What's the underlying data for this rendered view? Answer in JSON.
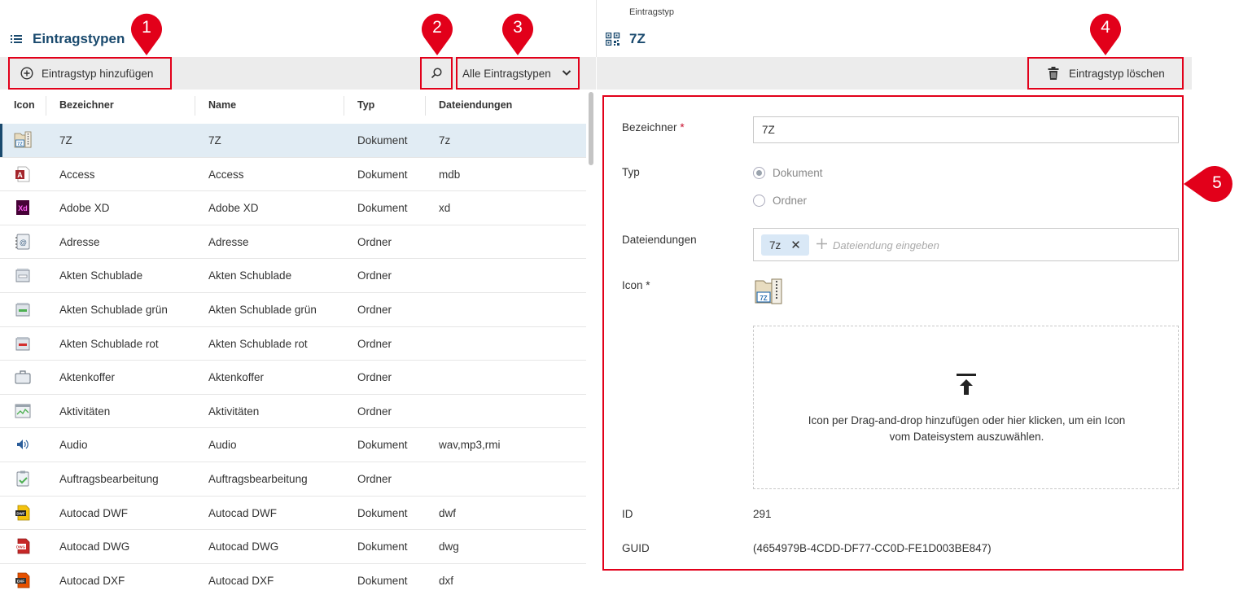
{
  "left": {
    "title": "Eintragstypen",
    "add_label": "Eintragstyp hinzufügen",
    "filter_label": "Alle Eintragstypen",
    "columns": [
      "Icon",
      "Bezeichner",
      "Name",
      "Typ",
      "Dateiendungen"
    ],
    "rows": [
      {
        "icon": "archive-7z-icon",
        "bez": "7Z",
        "name": "7Z",
        "typ": "Dokument",
        "ext": "7z",
        "selected": true
      },
      {
        "icon": "access-icon",
        "bez": "Access",
        "name": "Access",
        "typ": "Dokument",
        "ext": "mdb"
      },
      {
        "icon": "adobe-xd-icon",
        "bez": "Adobe XD",
        "name": "Adobe XD",
        "typ": "Dokument",
        "ext": "xd"
      },
      {
        "icon": "address-book-icon",
        "bez": "Adresse",
        "name": "Adresse",
        "typ": "Ordner",
        "ext": ""
      },
      {
        "icon": "drawer-icon",
        "bez": "Akten Schublade",
        "name": "Akten Schublade",
        "typ": "Ordner",
        "ext": ""
      },
      {
        "icon": "drawer-green-icon",
        "bez": "Akten Schublade grün",
        "name": "Akten Schublade grün",
        "typ": "Ordner",
        "ext": ""
      },
      {
        "icon": "drawer-red-icon",
        "bez": "Akten Schublade rot",
        "name": "Akten Schublade rot",
        "typ": "Ordner",
        "ext": ""
      },
      {
        "icon": "briefcase-icon",
        "bez": "Aktenkoffer",
        "name": "Aktenkoffer",
        "typ": "Ordner",
        "ext": ""
      },
      {
        "icon": "activity-chart-icon",
        "bez": "Aktivitäten",
        "name": "Aktivitäten",
        "typ": "Ordner",
        "ext": ""
      },
      {
        "icon": "audio-icon",
        "bez": "Audio",
        "name": "Audio",
        "typ": "Dokument",
        "ext": "wav,mp3,rmi"
      },
      {
        "icon": "clipboard-check-icon",
        "bez": "Auftragsbearbeitung",
        "name": "Auftragsbearbeitung",
        "typ": "Ordner",
        "ext": ""
      },
      {
        "icon": "autocad-dwf-icon",
        "bez": "Autocad DWF",
        "name": "Autocad DWF",
        "typ": "Dokument",
        "ext": "dwf"
      },
      {
        "icon": "autocad-dwg-icon",
        "bez": "Autocad DWG",
        "name": "Autocad DWG",
        "typ": "Dokument",
        "ext": "dwg"
      },
      {
        "icon": "autocad-dxf-icon",
        "bez": "Autocad DXF",
        "name": "Autocad DXF",
        "typ": "Dokument",
        "ext": "dxf"
      }
    ]
  },
  "right": {
    "caption": "Eintragstyp",
    "title": "7Z",
    "delete_label": "Eintragstyp löschen",
    "form": {
      "bezeichner_label": "Bezeichner",
      "bezeichner_value": "7Z",
      "typ_label": "Typ",
      "typ_options": [
        "Dokument",
        "Ordner"
      ],
      "typ_selected": "Dokument",
      "ext_label": "Dateiendungen",
      "ext_chip": "7z",
      "ext_placeholder": "Dateiendung eingeben",
      "icon_label": "Icon",
      "icon_preview_text": "7Z",
      "drop_text_1": "Icon per Drag-and-drop hinzufügen oder hier klicken, um ein Icon",
      "drop_text_2": "vom Dateisystem auszuwählen.",
      "id_label": "ID",
      "id_value": "291",
      "guid_label": "GUID",
      "guid_value": "(4654979B-4CDD-DF77-CC0D-FE1D003BE847)"
    }
  },
  "annotations": [
    "1",
    "2",
    "3",
    "4",
    "5"
  ],
  "colors": {
    "accent": "#1a4a6e",
    "highlight": "#e2001a",
    "selected_row": "#e1ecf4",
    "toolbar": "#ececec"
  }
}
